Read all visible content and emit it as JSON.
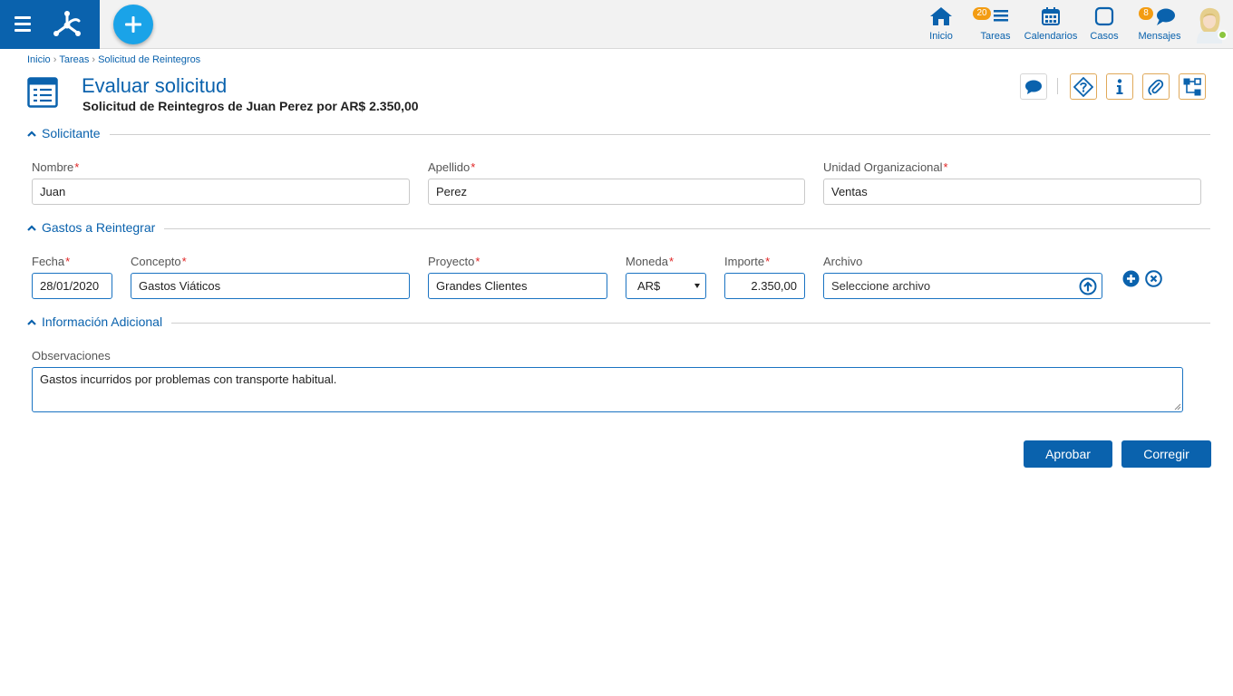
{
  "topbar": {
    "nav": [
      {
        "key": "inicio",
        "label": "Inicio"
      },
      {
        "key": "tareas",
        "label": "Tareas",
        "badge": "20"
      },
      {
        "key": "calendarios",
        "label": "Calendarios"
      },
      {
        "key": "casos",
        "label": "Casos"
      },
      {
        "key": "mensajes",
        "label": "Mensajes",
        "badge": "8"
      }
    ],
    "user_status": "online"
  },
  "breadcrumb": [
    "Inicio",
    "Tareas",
    "Solicitud de Reintegros"
  ],
  "header": {
    "title": "Evaluar solicitud",
    "subtitle": "Solicitud de Reintegros de Juan Perez por AR$ 2.350,00"
  },
  "toolbar": {
    "icons": [
      "comment-icon",
      "help-icon",
      "info-icon",
      "attachment-icon",
      "process-map-icon"
    ]
  },
  "sections": {
    "solicitante": {
      "title": "Solicitante",
      "fields": {
        "nombre": {
          "label": "Nombre",
          "value": "Juan",
          "required": true
        },
        "apellido": {
          "label": "Apellido",
          "value": "Perez",
          "required": true
        },
        "unidad": {
          "label": "Unidad Organizacional",
          "value": "Ventas",
          "required": true
        }
      }
    },
    "gastos": {
      "title": "Gastos a Reintegrar",
      "columns": {
        "fecha": {
          "label": "Fecha",
          "required": true
        },
        "concepto": {
          "label": "Concepto",
          "required": true
        },
        "proyecto": {
          "label": "Proyecto",
          "required": true
        },
        "moneda": {
          "label": "Moneda",
          "required": true
        },
        "importe": {
          "label": "Importe",
          "required": true
        },
        "archivo": {
          "label": "Archivo",
          "required": false
        }
      },
      "row": {
        "fecha": "28/01/2020",
        "concepto": "Gastos Viáticos",
        "proyecto": "Grandes Clientes",
        "moneda": "AR$",
        "importe": "2.350,00",
        "archivo_placeholder": "Seleccione archivo"
      }
    },
    "adicional": {
      "title": "Información Adicional",
      "observaciones_label": "Observaciones",
      "observaciones_value": "Gastos incurridos por problemas con transporte habitual."
    }
  },
  "actions": {
    "aprobar": "Aprobar",
    "corregir": "Corregir"
  },
  "colors": {
    "brand": "#0a62ad",
    "fab": "#1aa3e8",
    "badge": "#f39c12",
    "required": "#e02424",
    "toolbar_border": "#e0a95a",
    "status_online": "#8cc63f"
  }
}
